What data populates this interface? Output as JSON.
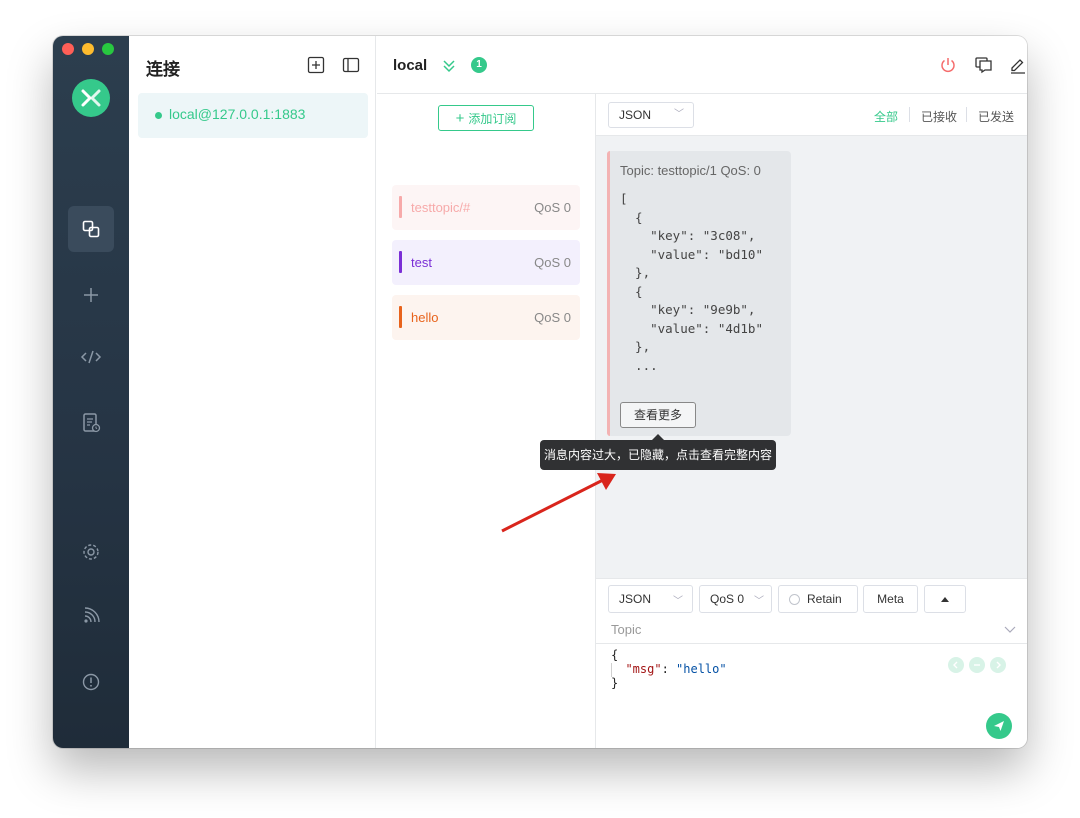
{
  "window": {
    "traffic_lights": {
      "close": "#ff5f57",
      "minimize": "#febc2e",
      "maximize": "#28c840"
    }
  },
  "rail": {
    "items": [
      {
        "name": "connections-icon",
        "active": true
      },
      {
        "name": "plus-icon",
        "active": false
      },
      {
        "name": "code-icon",
        "active": false
      },
      {
        "name": "log-icon",
        "active": false
      },
      {
        "name": "settings-icon",
        "active": false
      },
      {
        "name": "feed-icon",
        "active": false
      },
      {
        "name": "info-icon",
        "active": false
      }
    ]
  },
  "connections": {
    "title": "连接",
    "items": [
      {
        "label": "local@127.0.0.1:1883",
        "status_color": "#35c98b"
      }
    ]
  },
  "header": {
    "title": "local",
    "badge": "1"
  },
  "subscriptions": {
    "add_label": "添加订阅",
    "items": [
      {
        "topic": "testtopic/#",
        "qos": "QoS 0",
        "color": "#f7aaaa",
        "bg": "#fdf5f5"
      },
      {
        "topic": "test",
        "qos": "QoS 0",
        "color": "#7b2fd6",
        "bg": "#f3f0fd"
      },
      {
        "topic": "hello",
        "qos": "QoS 0",
        "color": "#e8631c",
        "bg": "#fdf4ef"
      }
    ]
  },
  "messages": {
    "format": "JSON",
    "filters": {
      "all": "全部",
      "received": "已接收",
      "sent": "已发送"
    },
    "card": {
      "meta": "Topic: testtopic/1   QoS: 0",
      "body": "[\n  {\n    \"key\": \"3c08\",\n    \"value\": \"bd10\"\n  },\n  {\n    \"key\": \"9e9b\",\n    \"value\": \"4d1b\"\n  },\n  ...",
      "more_label": "查看更多"
    },
    "tooltip": "消息内容过大，已隐藏，点击查看完整内容"
  },
  "publish": {
    "format": "JSON",
    "qos": "QoS 0",
    "retain_label": "Retain",
    "meta_label": "Meta",
    "topic_placeholder": "Topic",
    "payload_key": "\"msg\"",
    "payload_value": "\"hello\""
  },
  "colors": {
    "accent": "#35c98b",
    "danger": "#f56c6c",
    "annotation_arrow": "#d9251c"
  }
}
